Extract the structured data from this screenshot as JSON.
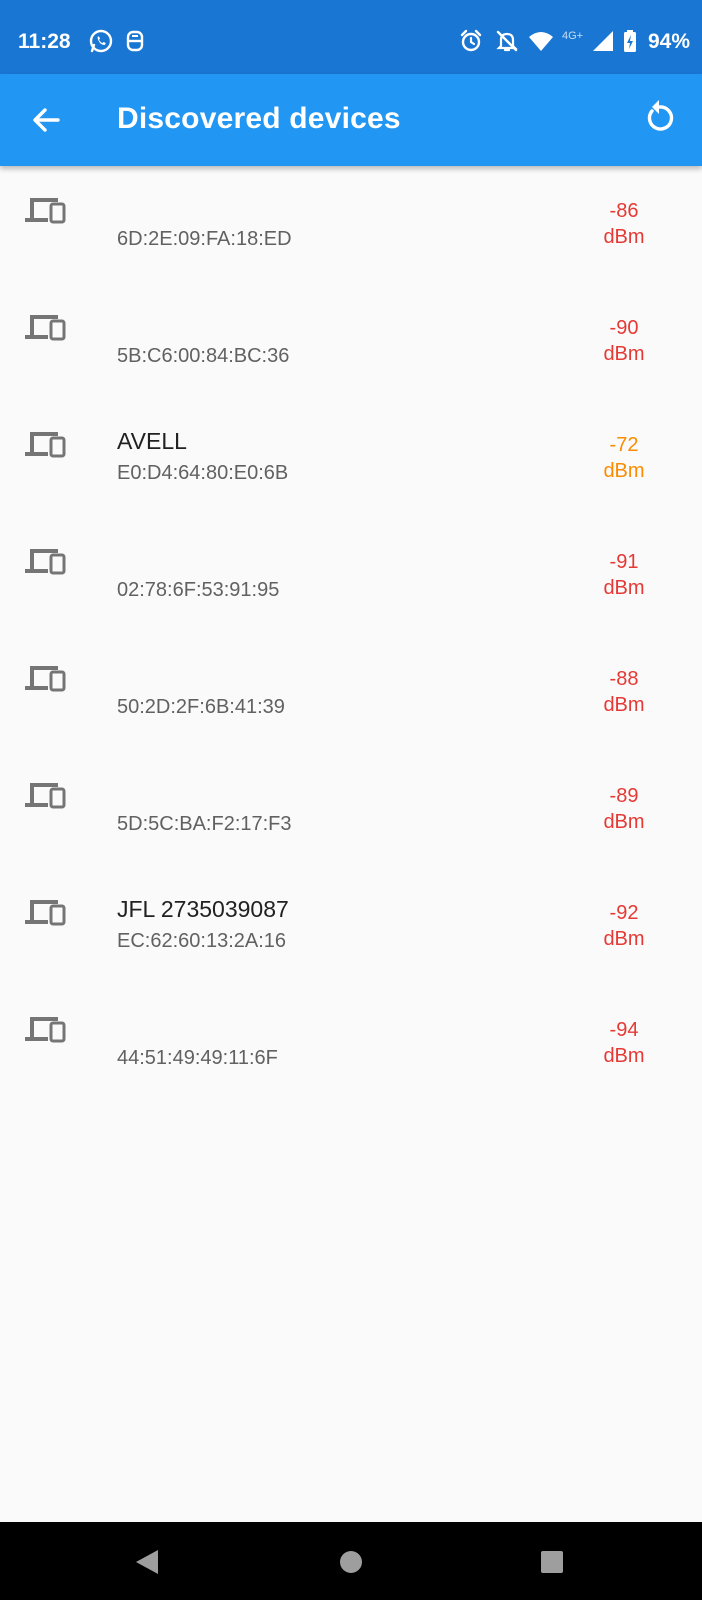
{
  "status_bar": {
    "time": "11:28",
    "network": "4G+",
    "battery": "94%"
  },
  "app_bar": {
    "title": "Discovered devices"
  },
  "devices": [
    {
      "name": "",
      "mac": "6D:2E:09:FA:18:ED",
      "rssi": "-86",
      "unit": "dBm",
      "strength": "weak"
    },
    {
      "name": "",
      "mac": "5B:C6:00:84:BC:36",
      "rssi": "-90",
      "unit": "dBm",
      "strength": "weak"
    },
    {
      "name": "AVELL",
      "mac": "E0:D4:64:80:E0:6B",
      "rssi": "-72",
      "unit": "dBm",
      "strength": "fair"
    },
    {
      "name": "",
      "mac": "02:78:6F:53:91:95",
      "rssi": "-91",
      "unit": "dBm",
      "strength": "weak"
    },
    {
      "name": "",
      "mac": "50:2D:2F:6B:41:39",
      "rssi": "-88",
      "unit": "dBm",
      "strength": "weak"
    },
    {
      "name": "",
      "mac": "5D:5C:BA:F2:17:F3",
      "rssi": "-89",
      "unit": "dBm",
      "strength": "weak"
    },
    {
      "name": "JFL 2735039087",
      "mac": "EC:62:60:13:2A:16",
      "rssi": "-92",
      "unit": "dBm",
      "strength": "weak"
    },
    {
      "name": "",
      "mac": "44:51:49:49:11:6F",
      "rssi": "-94",
      "unit": "dBm",
      "strength": "weak"
    }
  ],
  "colors": {
    "status_bar": "#1976d2",
    "app_bar": "#2196f3",
    "rssi_weak": "#e53935",
    "rssi_fair": "#fb8c00"
  },
  "icons": {
    "back": "arrow-left-icon",
    "refresh": "refresh-icon",
    "device": "devices-icon"
  }
}
